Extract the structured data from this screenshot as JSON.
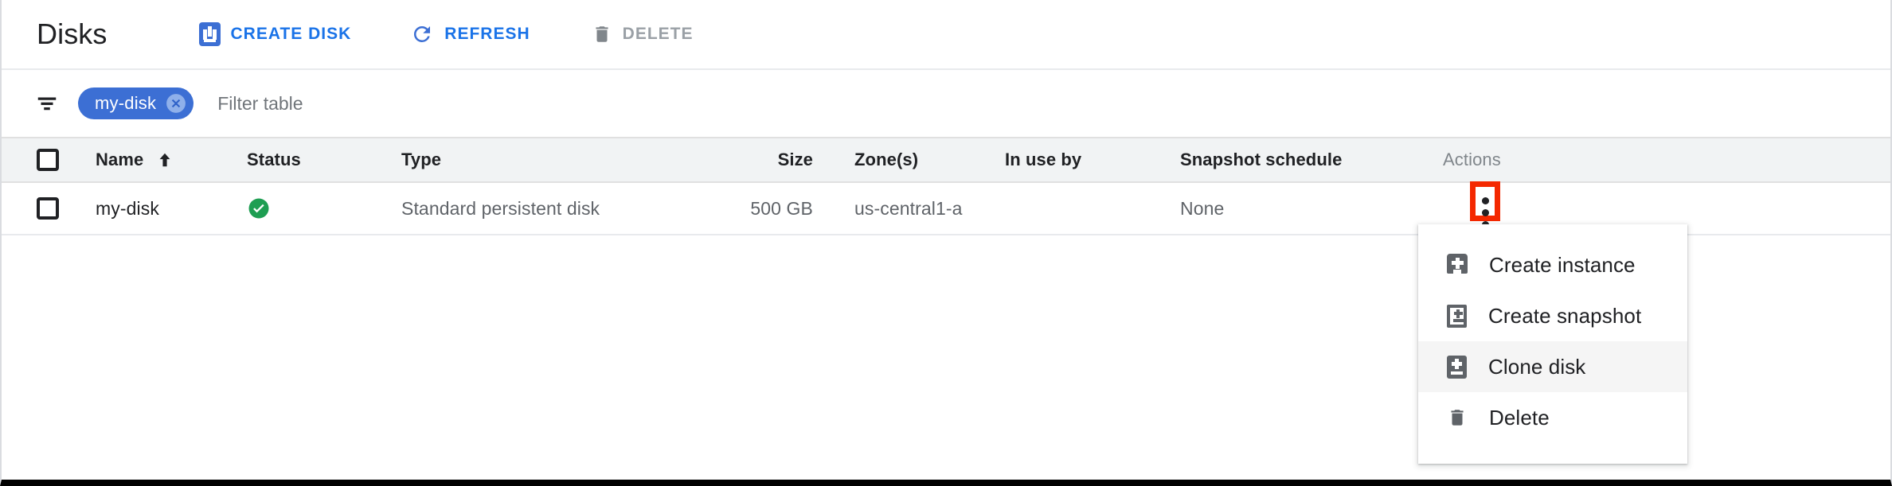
{
  "header": {
    "title": "Disks",
    "actions": [
      {
        "id": "create-disk",
        "label": "CREATE DISK",
        "icon": "create-disk-icon",
        "disabled": false,
        "color": "#1a73e8"
      },
      {
        "id": "refresh",
        "label": "REFRESH",
        "icon": "refresh-icon",
        "disabled": false,
        "color": "#1a73e8"
      },
      {
        "id": "delete",
        "label": "DELETE",
        "icon": "trash-icon",
        "disabled": true,
        "color": "#9aa0a6"
      }
    ]
  },
  "filter": {
    "icon": "filter-icon",
    "chip": {
      "label": "my-disk",
      "remove_icon": "close-circle-icon",
      "color": "#3c6fd4"
    },
    "input": {
      "value": "",
      "placeholder": "Filter table"
    }
  },
  "table": {
    "select_all_checkbox": {
      "checked": false
    },
    "columns": [
      {
        "key": "name",
        "label": "Name",
        "sorted": true,
        "sort_direction": "asc",
        "sort_icon": "arrow-up-icon"
      },
      {
        "key": "status",
        "label": "Status"
      },
      {
        "key": "type",
        "label": "Type"
      },
      {
        "key": "size",
        "label": "Size"
      },
      {
        "key": "zone",
        "label": "Zone(s)"
      },
      {
        "key": "inuseby",
        "label": "In use by"
      },
      {
        "key": "snapshot",
        "label": "Snapshot schedule"
      },
      {
        "key": "actions",
        "label": "Actions",
        "muted": true
      }
    ],
    "rows": [
      {
        "checked": false,
        "name": "my-disk",
        "status_icon": "check-circle-icon",
        "status_color": "#1e9e52",
        "type": "Standard persistent disk",
        "size": "500 GB",
        "zone": "us-central1-a",
        "in_use_by": "",
        "snapshot_schedule": "None",
        "actions_icon": "kebab-menu-icon"
      }
    ]
  },
  "actions_menu": {
    "open": true,
    "items": [
      {
        "id": "create-instance",
        "label": "Create instance",
        "icon": "create-instance-icon",
        "highlighted": false
      },
      {
        "id": "create-snapshot",
        "label": "Create snapshot",
        "icon": "create-snapshot-icon",
        "highlighted": false
      },
      {
        "id": "clone-disk",
        "label": "Clone disk",
        "icon": "clone-disk-icon",
        "highlighted": true
      },
      {
        "id": "delete",
        "label": "Delete",
        "icon": "trash-icon",
        "highlighted": false
      }
    ]
  },
  "annotation": {
    "highlight_color": "#f42800",
    "target": "kebab-menu-icon"
  }
}
